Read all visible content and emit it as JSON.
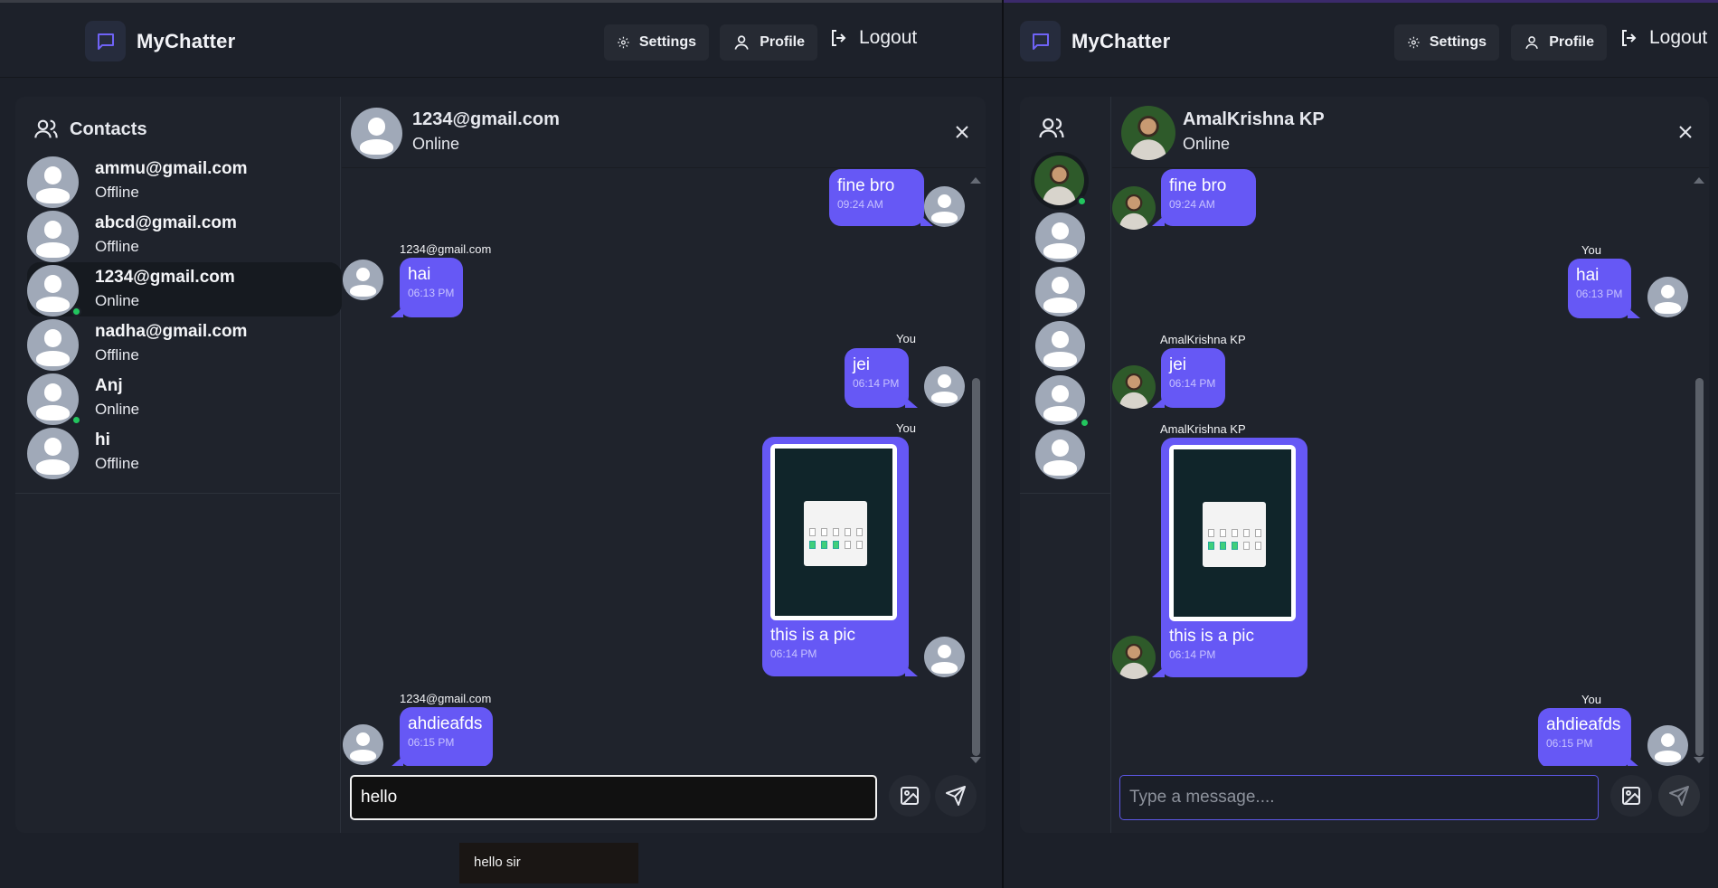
{
  "left": {
    "app_name": "MyChatter",
    "nav": {
      "settings": "Settings",
      "profile": "Profile",
      "logout": "Logout"
    },
    "contacts_title": "Contacts",
    "contacts": [
      {
        "name": "ammu@gmail.com",
        "status": "Offline"
      },
      {
        "name": "abcd@gmail.com",
        "status": "Offline"
      },
      {
        "name": "1234@gmail.com",
        "status": "Online"
      },
      {
        "name": "nadha@gmail.com",
        "status": "Offline"
      },
      {
        "name": "Anj",
        "status": "Online"
      },
      {
        "name": "hi",
        "status": "Offline"
      }
    ],
    "chat_header": {
      "name": "1234@gmail.com",
      "status": "Online"
    },
    "messages": [
      {
        "text": "fine bro",
        "time": "09:24 AM"
      },
      {
        "sender": "1234@gmail.com",
        "text": "hai",
        "time": "06:13 PM"
      },
      {
        "sender": "You",
        "text": "jei",
        "time": "06:14 PM"
      },
      {
        "sender": "You",
        "text": "this is a pic",
        "time": "06:14 PM"
      },
      {
        "sender": "1234@gmail.com",
        "text": "ahdieafds",
        "time": "06:15 PM"
      }
    ],
    "input_value": "hello",
    "tooltip": "hello sir"
  },
  "right": {
    "app_name": "MyChatter",
    "nav": {
      "settings": "Settings",
      "profile": "Profile",
      "logout": "Logout"
    },
    "chat_header": {
      "name": "AmalKrishna KP",
      "status": "Online"
    },
    "messages": [
      {
        "text": "fine bro",
        "time": "09:24 AM"
      },
      {
        "sender": "You",
        "text": "hai",
        "time": "06:13 PM"
      },
      {
        "sender": "AmalKrishna KP",
        "text": "jei",
        "time": "06:14 PM"
      },
      {
        "sender": "AmalKrishna KP",
        "text": "this is a pic",
        "time": "06:14 PM"
      },
      {
        "sender": "You",
        "text": "ahdieafds",
        "time": "06:15 PM"
      }
    ],
    "input_placeholder": "Type a message...."
  },
  "colors": {
    "accent": "#6658f5",
    "online": "#22c55e",
    "background": "#1c2029"
  }
}
